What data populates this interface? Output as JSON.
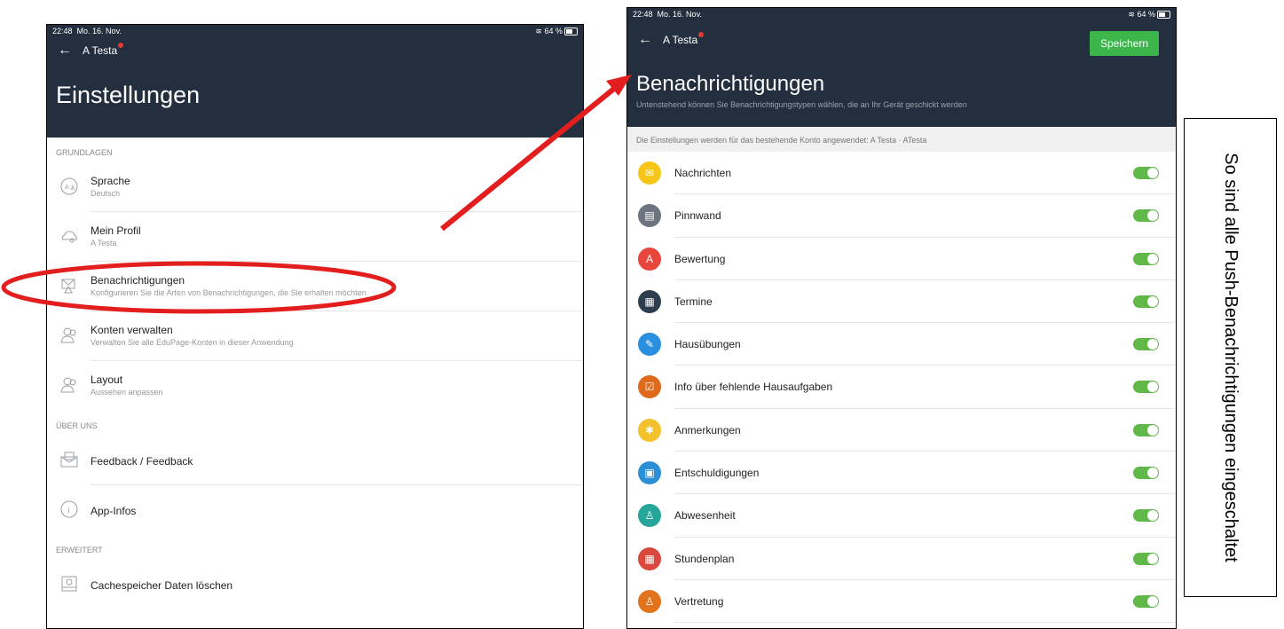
{
  "status": {
    "time": "22:48",
    "date": "Mo. 16. Nov.",
    "battery": "64 %"
  },
  "left": {
    "header": {
      "back_label": "A Testa",
      "title": "Einstellungen"
    },
    "sections": {
      "basics": "GRUNDLAGEN",
      "about": "ÜBER UNS",
      "advanced": "ERWEITERT"
    },
    "items": {
      "sprache": {
        "title": "Sprache",
        "subtitle": "Deutsch"
      },
      "profil": {
        "title": "Mein Profil",
        "subtitle": "A Testa"
      },
      "benachrichtigungen": {
        "title": "Benachrichtigungen",
        "subtitle": "Konfigurieren Sie die Arten von Benachrichtigungen, die Sie erhalten möchten"
      },
      "konten": {
        "title": "Konten verwalten",
        "subtitle": "Verwalten Sie alle EduPage-Konten in dieser Anwendung"
      },
      "layout": {
        "title": "Layout",
        "subtitle": "Aussehen anpassen"
      },
      "feedback": {
        "title": "Feedback / Feedback"
      },
      "appinfo": {
        "title": "App-Infos"
      },
      "cache": {
        "title": "Cachespeicher Daten löschen"
      }
    }
  },
  "right": {
    "header": {
      "back_label": "A Testa",
      "save_label": "Speichern",
      "title": "Benachrichtigungen",
      "subtitle": "Untenstehend können Sie Benachrichtigungstypen wählen, die an Ihr Gerät geschickt werden"
    },
    "info": "Die Einstellungen werden für das bestehende Konto angewendet: A Testa · ATesta",
    "notifications": [
      {
        "label": "Nachrichten",
        "color": "#f5c518",
        "glyph": "✉",
        "enabled": true
      },
      {
        "label": "Pinnwand",
        "color": "#6d7680",
        "glyph": "▤",
        "enabled": true
      },
      {
        "label": "Bewertung",
        "color": "#e8463c",
        "glyph": "A",
        "enabled": true
      },
      {
        "label": "Termine",
        "color": "#2f3e4f",
        "glyph": "▦",
        "enabled": true
      },
      {
        "label": "Hausübungen",
        "color": "#2b8fe0",
        "glyph": "✎",
        "enabled": true
      },
      {
        "label": "Info über fehlende Hausaufgaben",
        "color": "#e06a1b",
        "glyph": "☑",
        "enabled": true
      },
      {
        "label": "Anmerkungen",
        "color": "#f3c12b",
        "glyph": "✱",
        "enabled": true
      },
      {
        "label": "Entschuldigungen",
        "color": "#2c8fd6",
        "glyph": "▣",
        "enabled": true
      },
      {
        "label": "Abwesenheit",
        "color": "#26a69a",
        "glyph": "♙",
        "enabled": true
      },
      {
        "label": "Stundenplan",
        "color": "#d9473d",
        "glyph": "▦",
        "enabled": true
      },
      {
        "label": "Vertretung",
        "color": "#e0731c",
        "glyph": "♙",
        "enabled": true
      }
    ]
  },
  "note": {
    "text": "So sind alle Push-Benachrichtigungen eingeschaltet"
  },
  "colors": {
    "header": "#232f3e",
    "accent": "#3cb64a",
    "toggle": "#5fb848",
    "annotation": "#e31e1e"
  }
}
